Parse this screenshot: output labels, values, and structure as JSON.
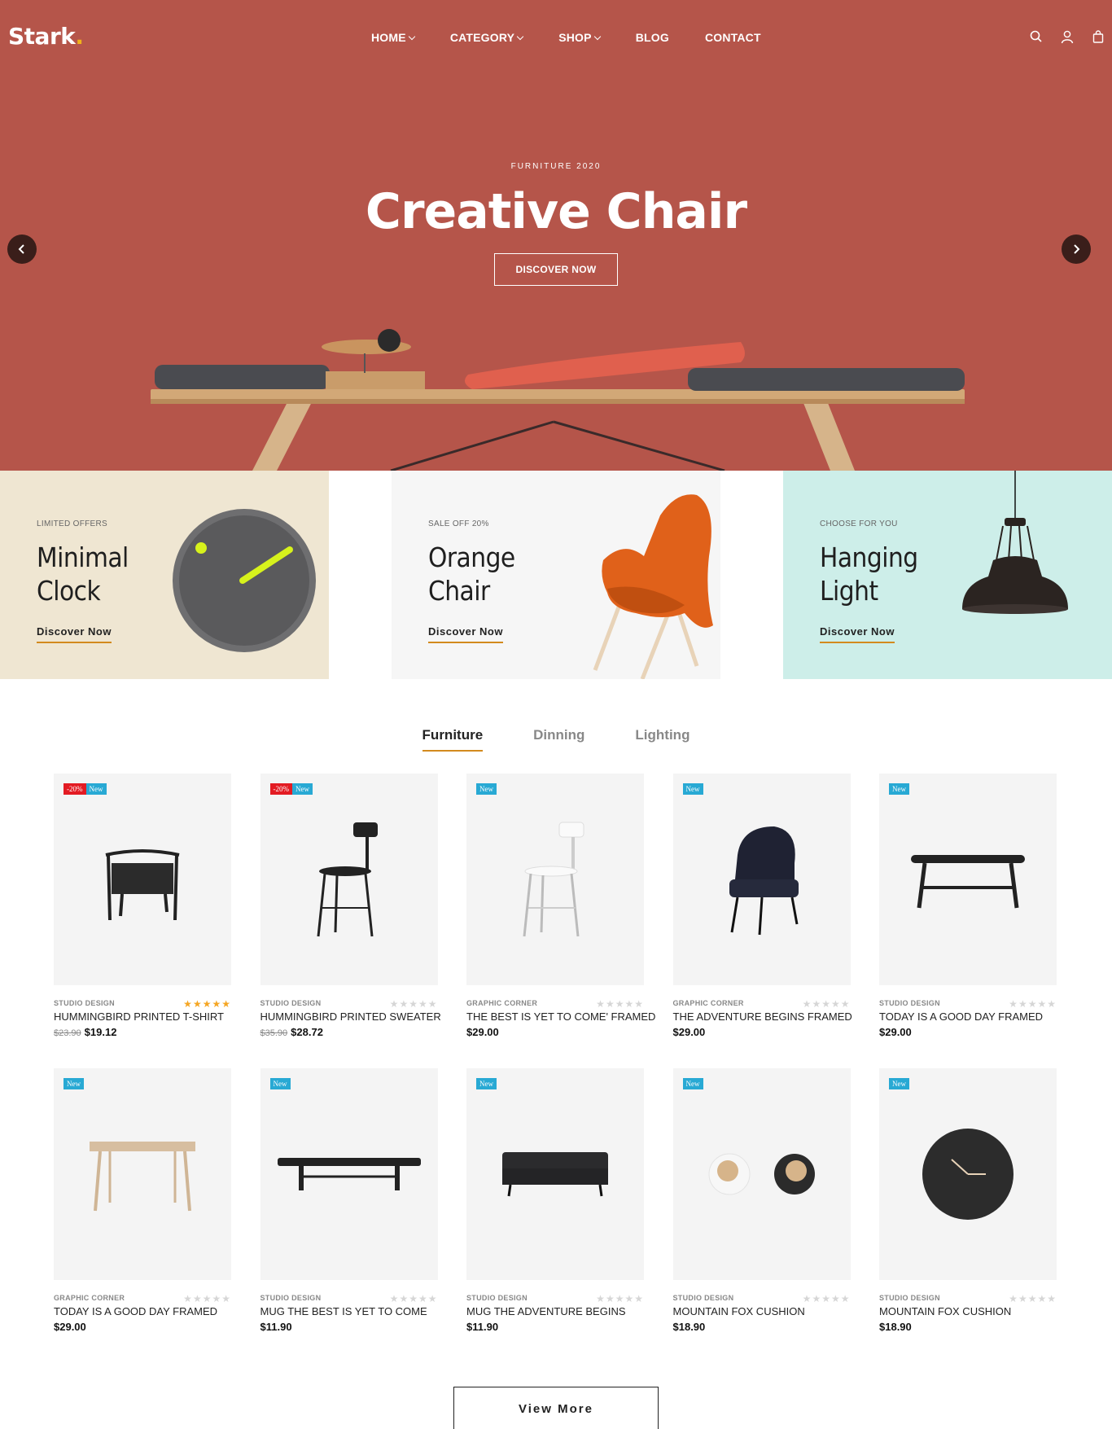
{
  "brand": {
    "name": "Stark",
    "dot": "."
  },
  "nav": [
    {
      "label": "HOME",
      "dropdown": true
    },
    {
      "label": "CATEGORY",
      "dropdown": true
    },
    {
      "label": "SHOP",
      "dropdown": true
    },
    {
      "label": "BLOG",
      "dropdown": false
    },
    {
      "label": "CONTACT",
      "dropdown": false
    }
  ],
  "header_icons": [
    "search-icon",
    "user-icon",
    "shopping-bag-icon"
  ],
  "hero": {
    "kicker": "FURNITURE 2020",
    "title": "Creative Chair",
    "button": "DISCOVER NOW",
    "background": "#b5554a"
  },
  "banners": [
    {
      "kicker": "LIMITED OFFERS",
      "title": "Minimal Clock",
      "link": "Discover Now",
      "background": "#efe6d2"
    },
    {
      "kicker": "SALE OFF 20%",
      "title": "Orange Chair",
      "link": "Discover Now",
      "background": "#f6f6f6"
    },
    {
      "kicker": "CHOOSE FOR YOU",
      "title": "Hanging Light",
      "link": "Discover Now",
      "background": "#cdeee9"
    }
  ],
  "tabs": [
    {
      "label": "Furniture",
      "active": true
    },
    {
      "label": "Dinning",
      "active": false
    },
    {
      "label": "Lighting",
      "active": false
    }
  ],
  "products": [
    {
      "brand": "STUDIO DESIGN",
      "name": "HUMMINGBIRD PRINTED T-SHIRT",
      "old_price": "$23.90",
      "price": "$19.12",
      "badges": [
        "-20%",
        "New"
      ],
      "rating": 5,
      "art": "armchair-black"
    },
    {
      "brand": "STUDIO DESIGN",
      "name": "HUMMINGBIRD PRINTED SWEATER",
      "old_price": "$35.90",
      "price": "$28.72",
      "badges": [
        "-20%",
        "New"
      ],
      "rating": 0,
      "art": "bar-chair-black"
    },
    {
      "brand": "GRAPHIC CORNER",
      "name": "THE BEST IS YET TO COME' FRAMED",
      "old_price": "",
      "price": "$29.00",
      "badges": [
        "New"
      ],
      "rating": 0,
      "art": "bar-chair-white"
    },
    {
      "brand": "GRAPHIC CORNER",
      "name": "THE ADVENTURE BEGINS FRAMED",
      "old_price": "",
      "price": "$29.00",
      "badges": [
        "New"
      ],
      "rating": 0,
      "art": "armchair-navy"
    },
    {
      "brand": "STUDIO DESIGN",
      "name": "TODAY IS A GOOD DAY FRAMED",
      "old_price": "",
      "price": "$29.00",
      "badges": [
        "New"
      ],
      "rating": 0,
      "art": "bench-black"
    },
    {
      "brand": "GRAPHIC CORNER",
      "name": "TODAY IS A GOOD DAY FRAMED",
      "old_price": "",
      "price": "$29.00",
      "badges": [
        "New"
      ],
      "rating": 0,
      "art": "bench-wood"
    },
    {
      "brand": "STUDIO DESIGN",
      "name": "MUG THE BEST IS YET TO COME",
      "old_price": "",
      "price": "$11.90",
      "badges": [
        "New"
      ],
      "rating": 0,
      "art": "daybed-black"
    },
    {
      "brand": "STUDIO DESIGN",
      "name": "MUG THE ADVENTURE BEGINS",
      "old_price": "",
      "price": "$11.90",
      "badges": [
        "New"
      ],
      "rating": 0,
      "art": "sofa-black"
    },
    {
      "brand": "STUDIO DESIGN",
      "name": "MOUNTAIN FOX CUSHION",
      "old_price": "",
      "price": "$18.90",
      "badges": [
        "New"
      ],
      "rating": 0,
      "art": "grinders"
    },
    {
      "brand": "STUDIO DESIGN",
      "name": "MOUNTAIN FOX CUSHION",
      "old_price": "",
      "price": "$18.90",
      "badges": [
        "New"
      ],
      "rating": 0,
      "art": "wall-clock"
    }
  ],
  "view_more": "View More",
  "colors": {
    "accent": "#d38a1e",
    "sale_badge": "#e31b23",
    "new_badge": "#28a9d4",
    "star": "#f5a623"
  }
}
